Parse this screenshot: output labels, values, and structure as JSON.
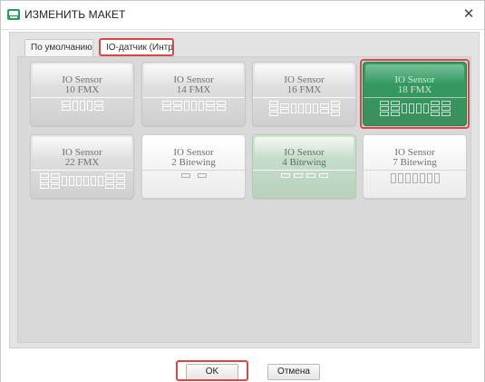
{
  "window": {
    "title": "ИЗМЕНИТЬ МАКЕТ",
    "close_glyph": "✕",
    "icon": "template-app-icon",
    "accent_color": "#2e9a5c",
    "highlight_color": "#d94848"
  },
  "tabs": [
    {
      "label": "По умолчанию",
      "active": false
    },
    {
      "label": "IO-датчик (Интра...",
      "active": true
    }
  ],
  "tiles": [
    {
      "line1": "IO Sensor",
      "line2": "10 FMX",
      "style": "gray",
      "selected": false
    },
    {
      "line1": "IO Sensor",
      "line2": "14 FMX",
      "style": "gray",
      "selected": false
    },
    {
      "line1": "IO Sensor",
      "line2": "16 FMX",
      "style": "gray",
      "selected": false
    },
    {
      "line1": "IO Sensor",
      "line2": "18 FMX",
      "style": "green",
      "selected": true
    },
    {
      "line1": "IO Sensor",
      "line2": "22 FMX",
      "style": "gray",
      "selected": false
    },
    {
      "line1": "IO Sensor",
      "line2": "2 Bitewing",
      "style": "white",
      "selected": false
    },
    {
      "line1": "IO Sensor",
      "line2": "4 Bitewing",
      "style": "lightgreen",
      "selected": false
    },
    {
      "line1": "IO Sensor",
      "line2": "7 Bitewing",
      "style": "white",
      "selected": false
    }
  ],
  "buttons": {
    "ok": "OK",
    "cancel": "Отмена"
  }
}
